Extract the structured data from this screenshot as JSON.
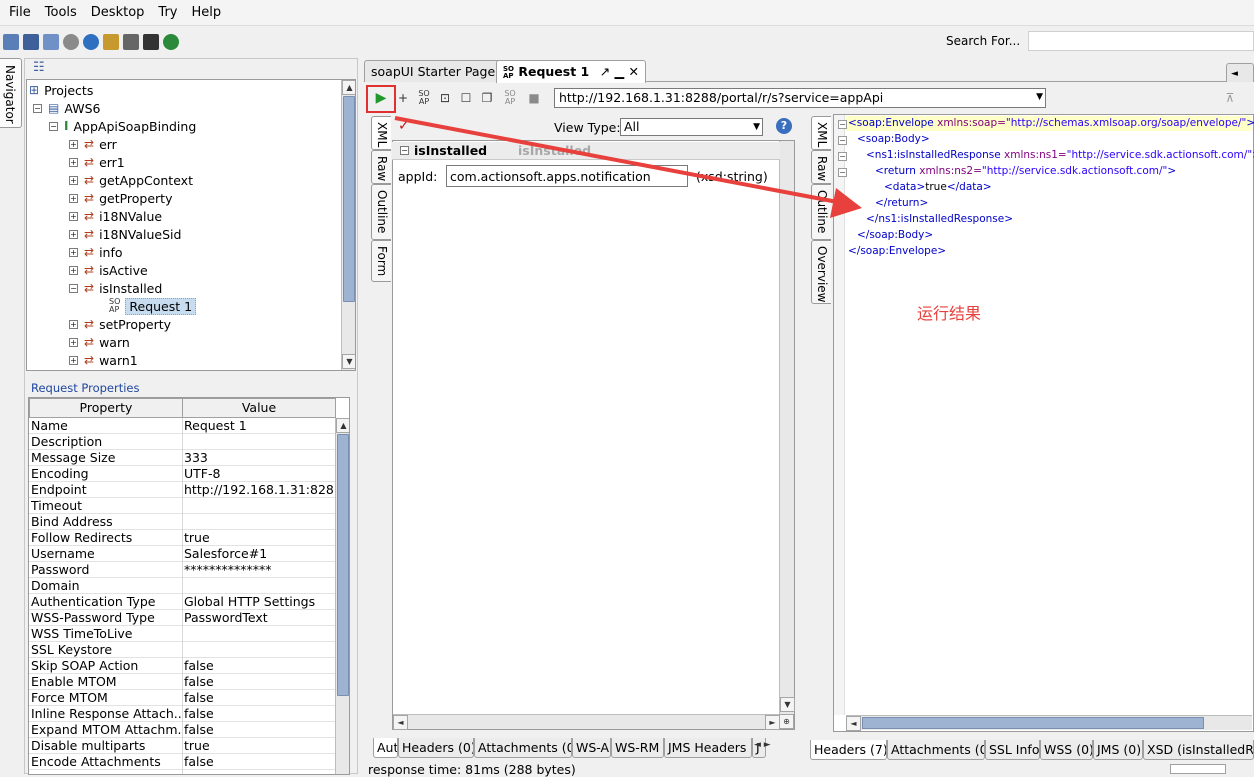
{
  "menu": [
    "File",
    "Tools",
    "Desktop",
    "Try",
    "Help"
  ],
  "search_label": "Search For...",
  "navigator_label": "Navigator",
  "tree": {
    "root": "Projects",
    "project": "AWS6",
    "binding": "AppApiSoapBinding",
    "ops": [
      "err",
      "err1",
      "getAppContext",
      "getProperty",
      "i18NValue",
      "i18NValueSid",
      "info",
      "isActive",
      "isInstalled"
    ],
    "request": "Request 1",
    "ops_after": [
      "setProperty",
      "warn",
      "warn1"
    ]
  },
  "request_properties": {
    "label": "Request Properties",
    "headers": [
      "Property",
      "Value"
    ],
    "rows": [
      [
        "Name",
        "Request 1"
      ],
      [
        "Description",
        ""
      ],
      [
        "Message Size",
        "333"
      ],
      [
        "Encoding",
        "UTF-8"
      ],
      [
        "Endpoint",
        "http://192.168.1.31:8288..."
      ],
      [
        "Timeout",
        ""
      ],
      [
        "Bind Address",
        ""
      ],
      [
        "Follow Redirects",
        "true"
      ],
      [
        "Username",
        "Salesforce#1"
      ],
      [
        "Password",
        "**************"
      ],
      [
        "Domain",
        ""
      ],
      [
        "Authentication Type",
        "Global HTTP Settings"
      ],
      [
        "WSS-Password Type",
        "PasswordText"
      ],
      [
        "WSS TimeToLive",
        ""
      ],
      [
        "SSL Keystore",
        ""
      ],
      [
        "Skip SOAP Action",
        "false"
      ],
      [
        "Enable MTOM",
        "false"
      ],
      [
        "Force MTOM",
        "false"
      ],
      [
        "Inline Response Attach...",
        "false"
      ],
      [
        "Expand MTOM Attachm...",
        "false"
      ],
      [
        "Disable multiparts",
        "true"
      ],
      [
        "Encode Attachments",
        "false"
      ]
    ]
  },
  "tabs": {
    "starter": "soapUI Starter Page",
    "request": "Request 1"
  },
  "endpoint_url": "http://192.168.1.31:8288/portal/r/s?service=appApi",
  "request_editor": {
    "vtabs": [
      "XML",
      "Raw",
      "Outline",
      "Form"
    ],
    "view_type_label": "View Type:",
    "view_type_value": "All",
    "operation": "isInstalled",
    "operation_ghost": "isInstalled",
    "field_label": "appId:",
    "field_value": "com.actionsoft.apps.notification",
    "field_type": "(xsd:string)"
  },
  "response_editor": {
    "vtabs": [
      "XML",
      "Raw",
      "Outline",
      "Overview"
    ],
    "xml": [
      {
        "tag": "<soap:Envelope",
        "attr": " xmlns:soap=",
        "val": "\"http://schemas.xmlsoap.org/soap/envelope/\"",
        "end": ">"
      },
      {
        "tag": "<soap:Body>",
        "attr": "",
        "val": "",
        "end": ""
      },
      {
        "tag": "<ns1:isInstalledResponse",
        "attr": " xmlns:ns1=",
        "val": "\"http://service.sdk.actionsoft.com/\"",
        "end": ">"
      },
      {
        "tag": "<return",
        "attr": " xmlns:ns2=",
        "val": "\"http://service.sdk.actionsoft.com/\"",
        "end": ">"
      },
      {
        "tag": "<data>",
        "attr": "",
        "val": "true",
        "end": "</data>"
      },
      {
        "tag": "</return>",
        "attr": "",
        "val": "",
        "end": ""
      },
      {
        "tag": "</ns1:isInstalledResponse>",
        "attr": "",
        "val": "",
        "end": ""
      },
      {
        "tag": "</soap:Body>",
        "attr": "",
        "val": "",
        "end": ""
      },
      {
        "tag": "</soap:Envelope>",
        "attr": "",
        "val": "",
        "end": ""
      }
    ]
  },
  "request_bottom_tabs": [
    "Aut",
    "Headers (0)",
    "Attachments (0)",
    "WS-A",
    "WS-RM",
    "JMS Headers",
    "J"
  ],
  "response_bottom_tabs": [
    "Headers (7)",
    "Attachments (0)",
    "SSL Info",
    "WSS (0)",
    "JMS (0)",
    "XSD (isInstalledR"
  ],
  "status_text": "response time: 81ms (288 bytes)",
  "annotation": "运行结果",
  "colors": {
    "annotation_red": "#e8403c",
    "xml_tag": "#0000c8",
    "xml_attr": "#7f007f",
    "xml_value": "#2a00ff",
    "selection": "#c8dcf0"
  }
}
